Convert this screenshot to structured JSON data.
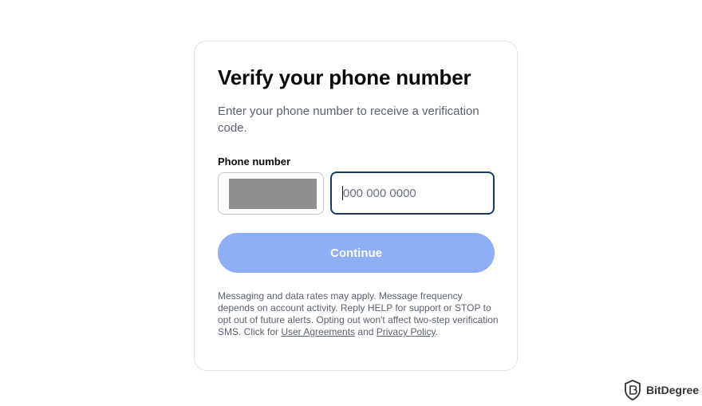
{
  "card": {
    "title": "Verify your phone number",
    "subtitle": "Enter your phone number to receive a verification code.",
    "phone_label": "Phone number",
    "phone_placeholder": "000 000 0000",
    "continue_label": "Continue",
    "disclaimer_text": "Messaging and data rates may apply. Message frequency depends on account activity. Reply HELP for support or STOP to opt out of future alerts. Opting out won't affect two-step verification SMS. Click for ",
    "user_agreements_link": "User Agreements",
    "and_text": " and ",
    "privacy_policy_link": "Privacy Policy",
    "end_punct": "."
  },
  "watermark": {
    "text": "BitDegree",
    "icon": "bitdegree-shield-logo"
  },
  "colors": {
    "button_bg": "#8eaff5",
    "input_focus_border": "#1b3a66",
    "muted_text": "#5b616e",
    "redaction": "#8f8f8f"
  }
}
